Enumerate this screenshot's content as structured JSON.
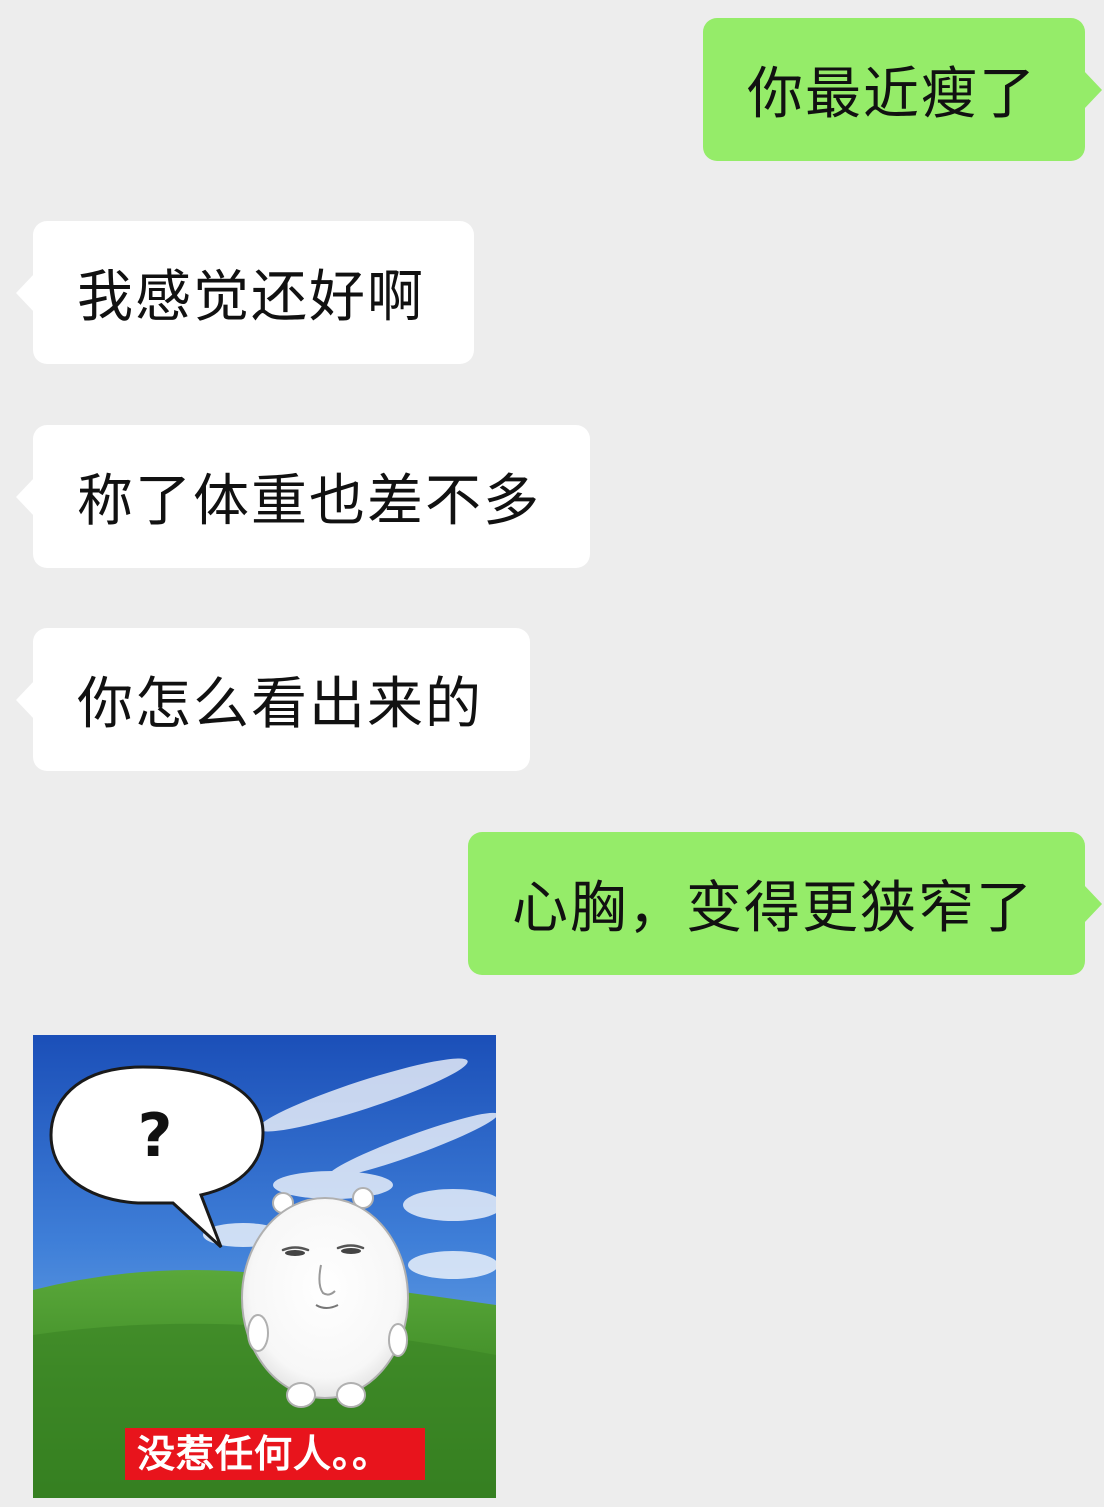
{
  "messages": [
    {
      "side": "out",
      "text": "你最近瘦了"
    },
    {
      "side": "in",
      "text": "我感觉还好啊"
    },
    {
      "side": "in",
      "text": "称了体重也差不多"
    },
    {
      "side": "in",
      "text": "你怎么看出来的"
    },
    {
      "side": "out",
      "text": "心胸，变得更狭窄了"
    }
  ],
  "sticker": {
    "speech_text": "?",
    "caption": "没惹任何人。。"
  },
  "colors": {
    "background": "#ededed",
    "outgoing_bubble": "#95ec69",
    "incoming_bubble": "#ffffff",
    "caption_bg": "#e8141c"
  }
}
